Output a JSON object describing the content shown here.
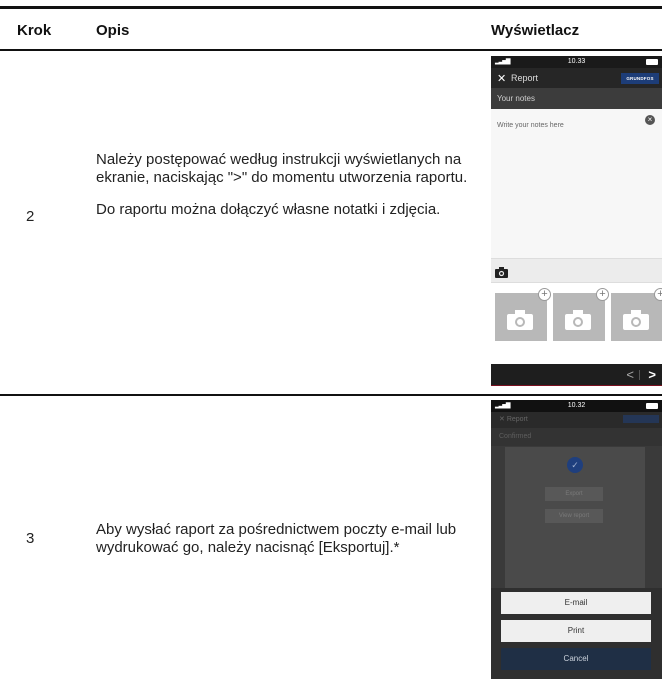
{
  "headers": {
    "step": "Krok",
    "description": "Opis",
    "display": "Wyświetlacz"
  },
  "rows": [
    {
      "step": "2",
      "paragraphs": [
        "Należy postępować według instrukcji wyświetlanych na ekranie, naciskając \">\" do momentu utworzenia raportu.",
        "Do raportu można dołączyć własne notatki i zdjęcia."
      ]
    },
    {
      "step": "3",
      "paragraphs": [
        "Aby wysłać raport za pośrednictwem poczty e-mail lub wydrukować go, należy nacisnąć [Eksportuj].*"
      ]
    }
  ],
  "screen1": {
    "time": "10.33",
    "close_icon": "close-icon",
    "title": "Report",
    "brand": "GRUNDFOS",
    "section": "Your notes",
    "placeholder": "Write your notes here",
    "clear_icon": "clear-icon",
    "camera_icon": "camera-icon",
    "thumb_count": 3,
    "prev": "<",
    "next": ">"
  },
  "screen2": {
    "time": "10.32",
    "title": "Report",
    "section": "Confirmed",
    "export_label": "Export",
    "view_report_label": "View report",
    "email_label": "E-mail",
    "print_label": "Print",
    "cancel_label": "Cancel"
  },
  "colors": {
    "status_bar": "#1a1a1a",
    "app_bar": "#262626",
    "brand_blue": "#1d3d78",
    "thumb_grey": "#b8b8b8",
    "cancel_bg": "#1f2f45"
  }
}
